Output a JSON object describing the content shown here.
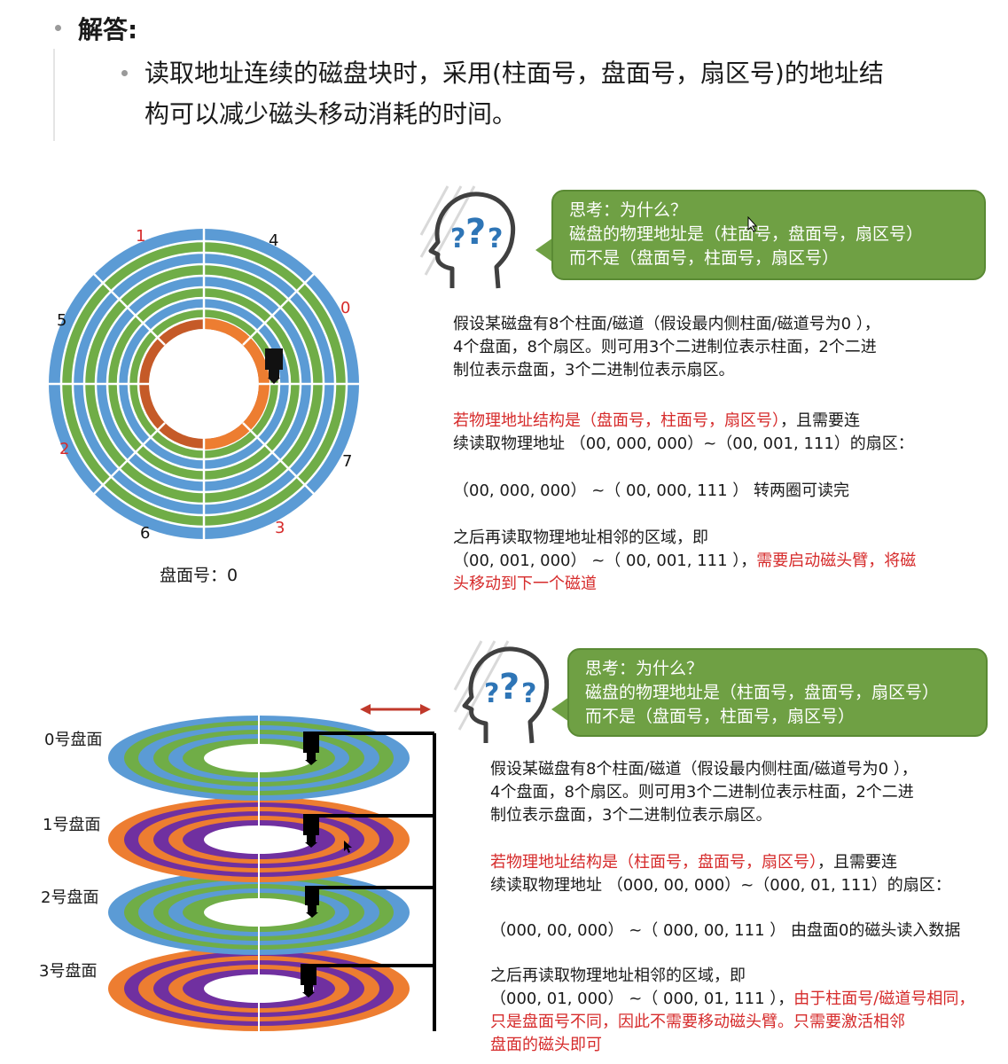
{
  "answer": {
    "heading": "解答:",
    "text_line1": "读取地址连续的磁盘块时，采用(柱面号，盘面号，扇区号)的地址结",
    "text_line2": "构可以减少磁头移动消耗的时间。"
  },
  "slide1": {
    "disk_labels": {
      "l1": "1",
      "l4": "4",
      "l0": "0",
      "l5": "5",
      "l2": "2",
      "l7": "7",
      "l6": "6",
      "l3": "3"
    },
    "platter_caption": "盘面号：0",
    "bubble": {
      "line1": "思考：为什么？",
      "line2": "磁盘的物理地址是（柱面号，盘面号，扇区号）",
      "line3": "而不是（盘面号，柱面号，扇区号）"
    },
    "p1_l1": "假设某磁盘有8个柱面/磁道（假设最内侧柱面/磁道号为0 ），",
    "p1_l2": "4个盘面，8个扇区。则可用3个二进制位表示柱面，2个二进",
    "p1_l3": "制位表示盘面，3个二进制位表示扇区。",
    "p2_red": "若物理地址结构是（盘面号，柱面号，扇区号）",
    "p2_rest": "，且需要连",
    "p2_l2": "续读取物理地址 （00, 000, 000）~（00, 001, 111）的扇区：",
    "p3": "（00, 000, 000） ~（ 00, 000, 111 ） 转两圈可读完",
    "p4_l1": "之后再读取物理地址相邻的区域，即",
    "p4_l2_black": "（00, 001, 000） ~（ 00, 001, 111 ），",
    "p4_l2_red": "需要启动磁头臂，将磁",
    "p4_l3_red": "头移动到下一个磁道"
  },
  "slide2": {
    "platters": [
      "0号盘面",
      "1号盘面",
      "2号盘面",
      "3号盘面"
    ],
    "bubble": {
      "line1": "思考：为什么？",
      "line2": "磁盘的物理地址是（柱面号，盘面号，扇区号）",
      "line3": "而不是（盘面号，柱面号，扇区号）"
    },
    "p1_l1": "假设某磁盘有8个柱面/磁道（假设最内侧柱面/磁道号为0 ），",
    "p1_l2": "4个盘面，8个扇区。则可用3个二进制位表示柱面，2个二进",
    "p1_l3": "制位表示盘面，3个二进制位表示扇区。",
    "p2_red": "若物理地址结构是（柱面号，盘面号，扇区号）",
    "p2_rest": "，且需要连",
    "p2_l2": "续读取物理地址 （000, 00, 000）~（000, 01, 111）的扇区：",
    "p3": "（000, 00, 000） ~（ 000, 00, 111 ） 由盘面0的磁头读入数据",
    "p4_l1": "之后再读取物理地址相邻的区域，即",
    "p4_l2_black": "（000, 01, 000） ~（ 000, 01, 111 ），",
    "p4_l2_red": "由于柱面号/磁道号相同，",
    "p4_l3_red": "只是盘面号不同，因此不需要移动磁头臂。只需要激活相邻",
    "p4_l4_red": "盘面的磁头即可"
  },
  "colors": {
    "blue": "#5b9bd5",
    "green": "#70ad47",
    "orange": "#ed7d31",
    "purple": "#7030a0",
    "red_text": "#d62b2b",
    "bubble": "#6fa044"
  }
}
